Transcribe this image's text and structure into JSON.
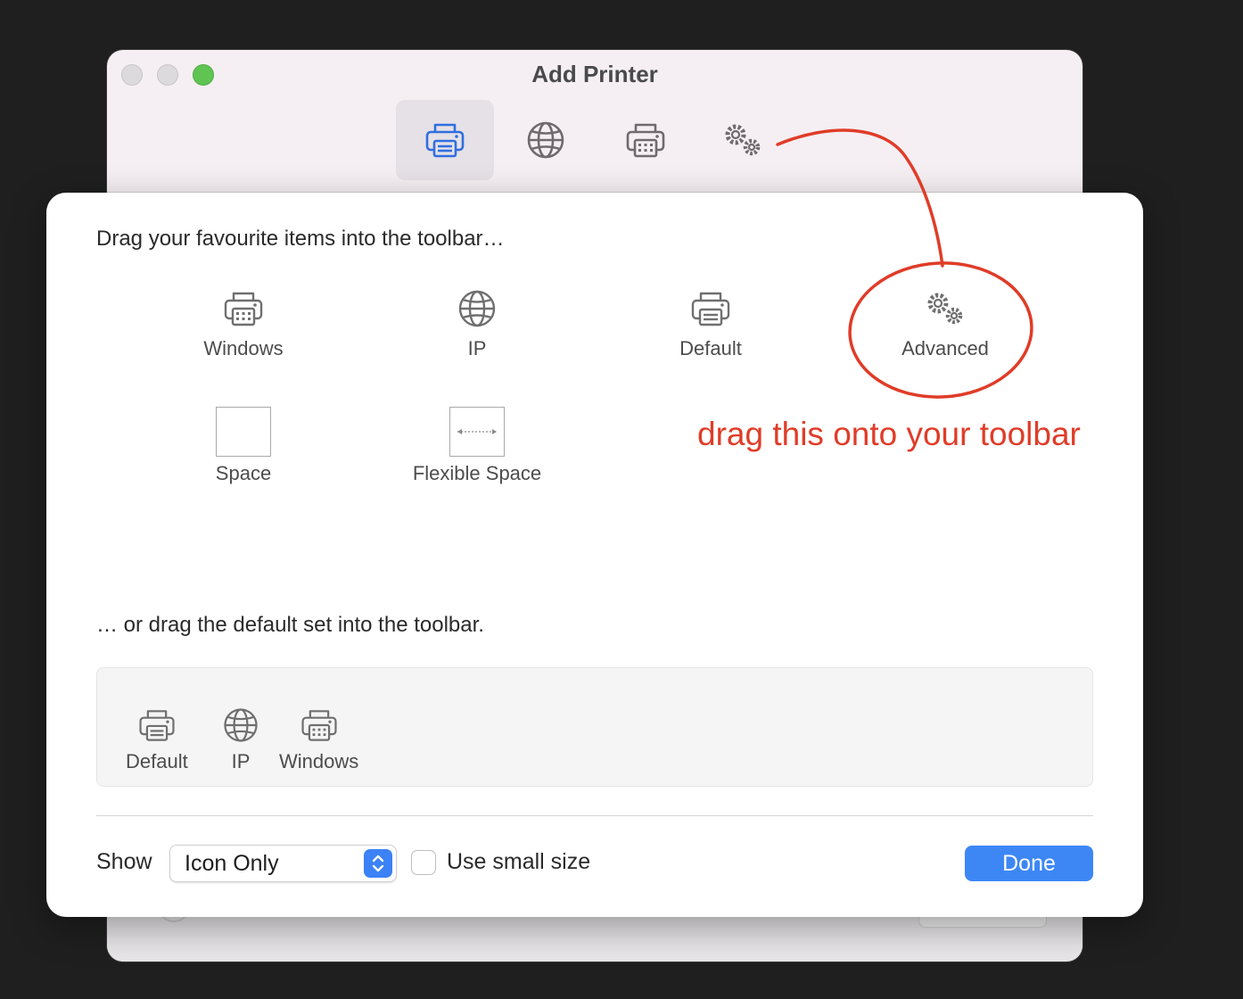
{
  "window": {
    "title": "Add Printer",
    "toolbar": [
      {
        "name": "default",
        "icon": "printer-icon",
        "active": true
      },
      {
        "name": "ip",
        "icon": "globe-icon",
        "active": false
      },
      {
        "name": "windows",
        "icon": "windows-printer-icon",
        "active": false
      },
      {
        "name": "advanced",
        "icon": "gears-icon",
        "active": false
      }
    ]
  },
  "sheet": {
    "heading": "Drag your favourite items into the toolbar…",
    "palette": [
      {
        "label": "Windows",
        "icon": "windows-printer-icon"
      },
      {
        "label": "IP",
        "icon": "globe-icon"
      },
      {
        "label": "Default",
        "icon": "printer-icon"
      },
      {
        "label": "Advanced",
        "icon": "gears-icon"
      },
      {
        "label": "Space",
        "icon": "space-box"
      },
      {
        "label": "Flexible Space",
        "icon": "flexible-space-box"
      }
    ],
    "default_heading": "… or drag the default set into the toolbar.",
    "default_set": [
      {
        "label": "Default",
        "icon": "printer-icon"
      },
      {
        "label": "IP",
        "icon": "globe-icon"
      },
      {
        "label": "Windows",
        "icon": "windows-printer-icon"
      }
    ],
    "show_label": "Show",
    "show_value": "Icon Only",
    "small_size_label": "Use small size",
    "small_size_checked": false,
    "done_label": "Done"
  },
  "annotation": {
    "text": "drag this onto your toolbar",
    "color": "#e03c28"
  },
  "colors": {
    "accent": "#3d87f5",
    "active_toolbar_icon": "#2f6fe0"
  }
}
